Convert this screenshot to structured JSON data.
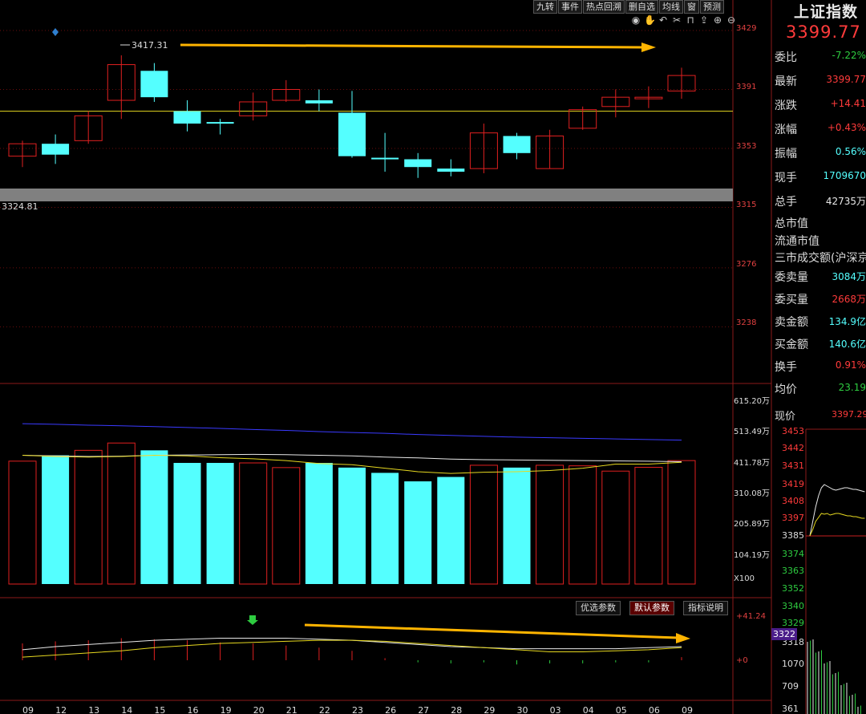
{
  "toolbar": [
    "九转",
    "事件",
    "热点回溯",
    "删自选",
    "均线",
    "窗",
    "预测"
  ],
  "tools": [
    "eye-icon",
    "hand-icon",
    "undo-icon",
    "scissors-icon",
    "lock-icon",
    "export-icon",
    "zoom-in-icon",
    "zoom-out-icon"
  ],
  "price_axis": [
    "3429",
    "3391",
    "3353",
    "3315",
    "3276",
    "3238"
  ],
  "volume_axis": [
    "615.20万",
    "513.49万",
    "411.78万",
    "310.08万",
    "205.89万",
    "104.19万",
    "X100"
  ],
  "indicator_axis": [
    "+41.24",
    "+0"
  ],
  "x_dates": [
    "09",
    "12",
    "13",
    "14",
    "15",
    "16",
    "19",
    "20",
    "21",
    "22",
    "23",
    "26",
    "27",
    "28",
    "29",
    "30",
    "03",
    "04",
    "05",
    "06",
    "09"
  ],
  "annotations": {
    "high": "3417.31",
    "low": "3324.81"
  },
  "indicator_tabs": [
    "优选参数",
    "默认参数",
    "指标说明"
  ],
  "colors": {
    "up": "#e02020",
    "down": "#54ffff",
    "ma_yellow": "#e6d820",
    "ma_white": "#e8e8e8",
    "ma_blue": "#3a3aff",
    "arrow": "#ffb400"
  },
  "chart_data": {
    "type": "candlestick",
    "ylim": [
      3305,
      3440
    ],
    "candles": [
      {
        "d": "09",
        "o": 3348,
        "c": 3356,
        "h": 3358,
        "l": 3341
      },
      {
        "d": "12",
        "o": 3356,
        "c": 3349,
        "h": 3362,
        "l": 3343
      },
      {
        "d": "13",
        "o": 3358,
        "c": 3374,
        "h": 3377,
        "l": 3356
      },
      {
        "d": "14",
        "o": 3384,
        "c": 3407,
        "h": 3413,
        "l": 3372
      },
      {
        "d": "15",
        "o": 3403,
        "c": 3386,
        "h": 3408,
        "l": 3383
      },
      {
        "d": "16",
        "o": 3377,
        "c": 3369,
        "h": 3384,
        "l": 3364
      },
      {
        "d": "19",
        "o": 3370,
        "c": 3369,
        "h": 3372,
        "l": 3362
      },
      {
        "d": "20",
        "o": 3374,
        "c": 3383,
        "h": 3389,
        "l": 3371
      },
      {
        "d": "21",
        "o": 3384,
        "c": 3391,
        "h": 3397,
        "l": 3383
      },
      {
        "d": "22",
        "o": 3384,
        "c": 3382,
        "h": 3391,
        "l": 3377
      },
      {
        "d": "23",
        "o": 3376,
        "c": 3348,
        "h": 3390,
        "l": 3347
      },
      {
        "d": "26",
        "o": 3347,
        "c": 3346,
        "h": 3363,
        "l": 3338
      },
      {
        "d": "27",
        "o": 3346,
        "c": 3341,
        "h": 3350,
        "l": 3334
      },
      {
        "d": "28",
        "o": 3340,
        "c": 3338,
        "h": 3346,
        "l": 3335
      },
      {
        "d": "29",
        "o": 3340,
        "c": 3363,
        "h": 3369,
        "l": 3337
      },
      {
        "d": "30",
        "o": 3361,
        "c": 3350,
        "h": 3363,
        "l": 3346
      },
      {
        "d": "03",
        "o": 3340,
        "c": 3361,
        "h": 3365,
        "l": 3340
      },
      {
        "d": "04",
        "o": 3366,
        "c": 3378,
        "h": 3380,
        "l": 3365
      },
      {
        "d": "05",
        "o": 3380,
        "c": 3386,
        "h": 3391,
        "l": 3373
      },
      {
        "d": "06",
        "o": 3385,
        "c": 3386,
        "h": 3393,
        "l": 3379
      },
      {
        "d": "09",
        "o": 3390,
        "c": 3400,
        "h": 3405,
        "l": 3385
      }
    ],
    "ref_line": 3377,
    "volume": {
      "ylim": [
        0,
        680
      ],
      "values": [
        420,
        440,
        457,
        482,
        457,
        414,
        414,
        414,
        398,
        414,
        398,
        380,
        351,
        366,
        406,
        398,
        406,
        404,
        386,
        399,
        422
      ],
      "ma_white": [
        440,
        438,
        436,
        437,
        440,
        441,
        442,
        443,
        442,
        440,
        438,
        434,
        431,
        427,
        425,
        424,
        423,
        422,
        421,
        420,
        418
      ],
      "ma_yellow": [
        440,
        436,
        434,
        436,
        440,
        438,
        432,
        428,
        422,
        412,
        408,
        396,
        384,
        378,
        382,
        384,
        388,
        396,
        410,
        410,
        416
      ],
      "ma_blue": [
        548,
        546,
        543,
        541,
        538,
        535,
        532,
        528,
        525,
        521,
        518,
        515,
        511,
        508,
        505,
        502,
        500,
        498,
        496,
        494,
        492
      ]
    },
    "indicator": {
      "ylim": [
        0,
        41.24
      ],
      "bars": [
        16,
        18,
        19,
        21,
        20,
        19,
        17,
        16,
        14,
        12,
        9,
        2,
        -2,
        -3,
        -2,
        -4,
        -3,
        -3,
        -2,
        -2,
        3
      ],
      "white": [
        10,
        13,
        15,
        17,
        19,
        20,
        21,
        21,
        21,
        20,
        19,
        17,
        15,
        13,
        12,
        11,
        11,
        11,
        11,
        12,
        13
      ],
      "yellow": [
        3,
        5,
        7,
        9,
        12,
        14,
        16,
        17,
        18,
        19,
        19,
        18,
        16,
        14,
        12,
        10,
        8,
        8,
        9,
        10,
        12
      ]
    }
  },
  "quote": {
    "title": "上证指数",
    "price": "3399.77",
    "rows": [
      {
        "k": "委比",
        "v": "-7.22%",
        "c": "#2ecc40"
      },
      {
        "k": "最新",
        "v": "3399.77",
        "c": "#ff3b3b"
      },
      {
        "k": "涨跌",
        "v": "+14.41",
        "c": "#ff3b3b"
      },
      {
        "k": "涨幅",
        "v": "+0.43%",
        "c": "#ff3b3b"
      },
      {
        "k": "振幅",
        "v": "0.56%",
        "c": "#54ffff"
      },
      {
        "k": "现手",
        "v": "1709670",
        "c": "#54ffff"
      },
      {
        "k": "总手",
        "v": "42735万",
        "c": "#e8e8e8"
      }
    ],
    "plain": [
      "总市值",
      "流通市值",
      "三市成交额(沪深京"
    ],
    "rows2": [
      {
        "k": "委卖量",
        "v": "3084万",
        "c": "#54ffff"
      },
      {
        "k": "委买量",
        "v": "2668万",
        "c": "#ff3b3b"
      },
      {
        "k": "卖金额",
        "v": "134.9亿",
        "c": "#54ffff"
      },
      {
        "k": "买金额",
        "v": "140.6亿",
        "c": "#54ffff"
      },
      {
        "k": "换手",
        "v": "0.91%",
        "c": "#ff3b3b"
      },
      {
        "k": "均价",
        "v": "23.19",
        "c": "#2ecc40"
      }
    ],
    "now_label": "现价",
    "now_value": "3397.29"
  },
  "mini_chart": {
    "up_labels": [
      "3453",
      "3442",
      "3431",
      "3419",
      "3408",
      "3397"
    ],
    "base_label": "3385",
    "down_labels": [
      "3374",
      "3363",
      "3352",
      "3340",
      "3329"
    ],
    "highlight": "3322",
    "partial": "3318",
    "vol_labels": [
      "1070",
      "709",
      "361"
    ]
  }
}
